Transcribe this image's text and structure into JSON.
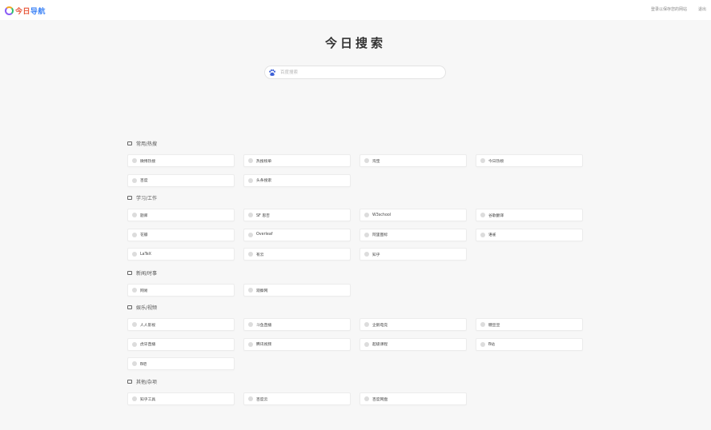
{
  "header": {
    "logo_text_a": "今日",
    "logo_text_b": "导航",
    "links": [
      "登录以保存您的网站",
      "退出"
    ]
  },
  "page_title": "今日搜索",
  "search": {
    "placeholder": "百度搜索",
    "engine_icon": "baidu-paw-icon"
  },
  "sections": [
    {
      "title": "常用/热搜",
      "items": [
        "微博热搜",
        "热搜榜单",
        "淘宝",
        "今日热榜",
        "百度",
        "头条搜索"
      ]
    },
    {
      "title": "学习/工作",
      "items": [
        "题库",
        "SF 思否",
        "W3school",
        "谷歌翻译",
        "花瓣",
        "Overleaf",
        "阿里图标",
        "语雀",
        "LaTeX",
        "有云",
        "知乎"
      ]
    },
    {
      "title": "新闻/时事",
      "items": [
        "网易",
        "观察网"
      ]
    },
    {
      "title": "娱乐/视频",
      "items": [
        "人人影视",
        "斗鱼直播",
        "企鹅电竞",
        "糖豆豆",
        "虎牙直播",
        "腾讯视频",
        "超级课程",
        "B站",
        "B吧"
      ]
    },
    {
      "title": "其他/杂项",
      "items": [
        "知乎工具",
        "百度云",
        "百度网盘"
      ]
    }
  ]
}
